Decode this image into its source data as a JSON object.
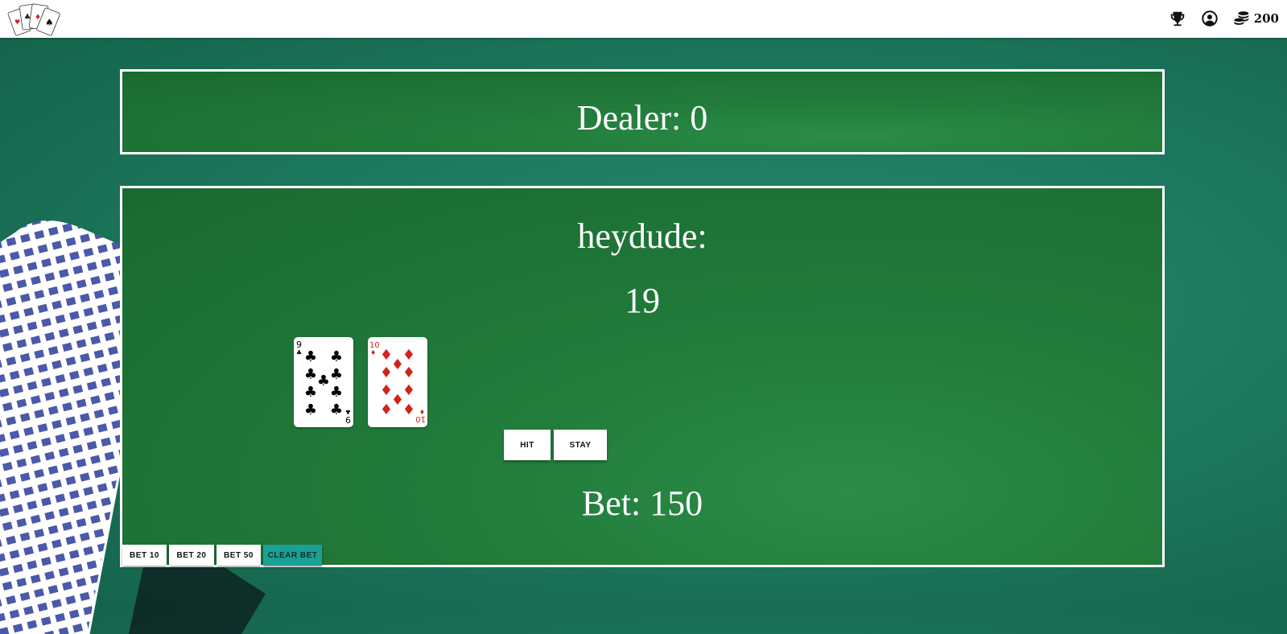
{
  "navbar": {
    "icons": {
      "trophy": "trophy-icon",
      "profile": "user-circle-icon",
      "coins": "coins-icon"
    },
    "coins": "200"
  },
  "dealer": {
    "label": "Dealer: 0"
  },
  "player": {
    "name": "heydude:",
    "score": "19",
    "cards": [
      {
        "rank": "9",
        "suit": "clubs",
        "color": "#000000"
      },
      {
        "rank": "10",
        "suit": "diamonds",
        "color": "#d0241b"
      }
    ],
    "actions": {
      "hit": "HIT",
      "stay": "STAY"
    },
    "bet": "Bet: 150"
  },
  "bet_controls": {
    "bet10": "BET 10",
    "bet20": "BET 20",
    "bet50": "BET 50",
    "clear": "CLEAR BET"
  },
  "colors": {
    "felt": "#1d7a5e",
    "table": "#217a3a",
    "accent": "#1aa195"
  }
}
